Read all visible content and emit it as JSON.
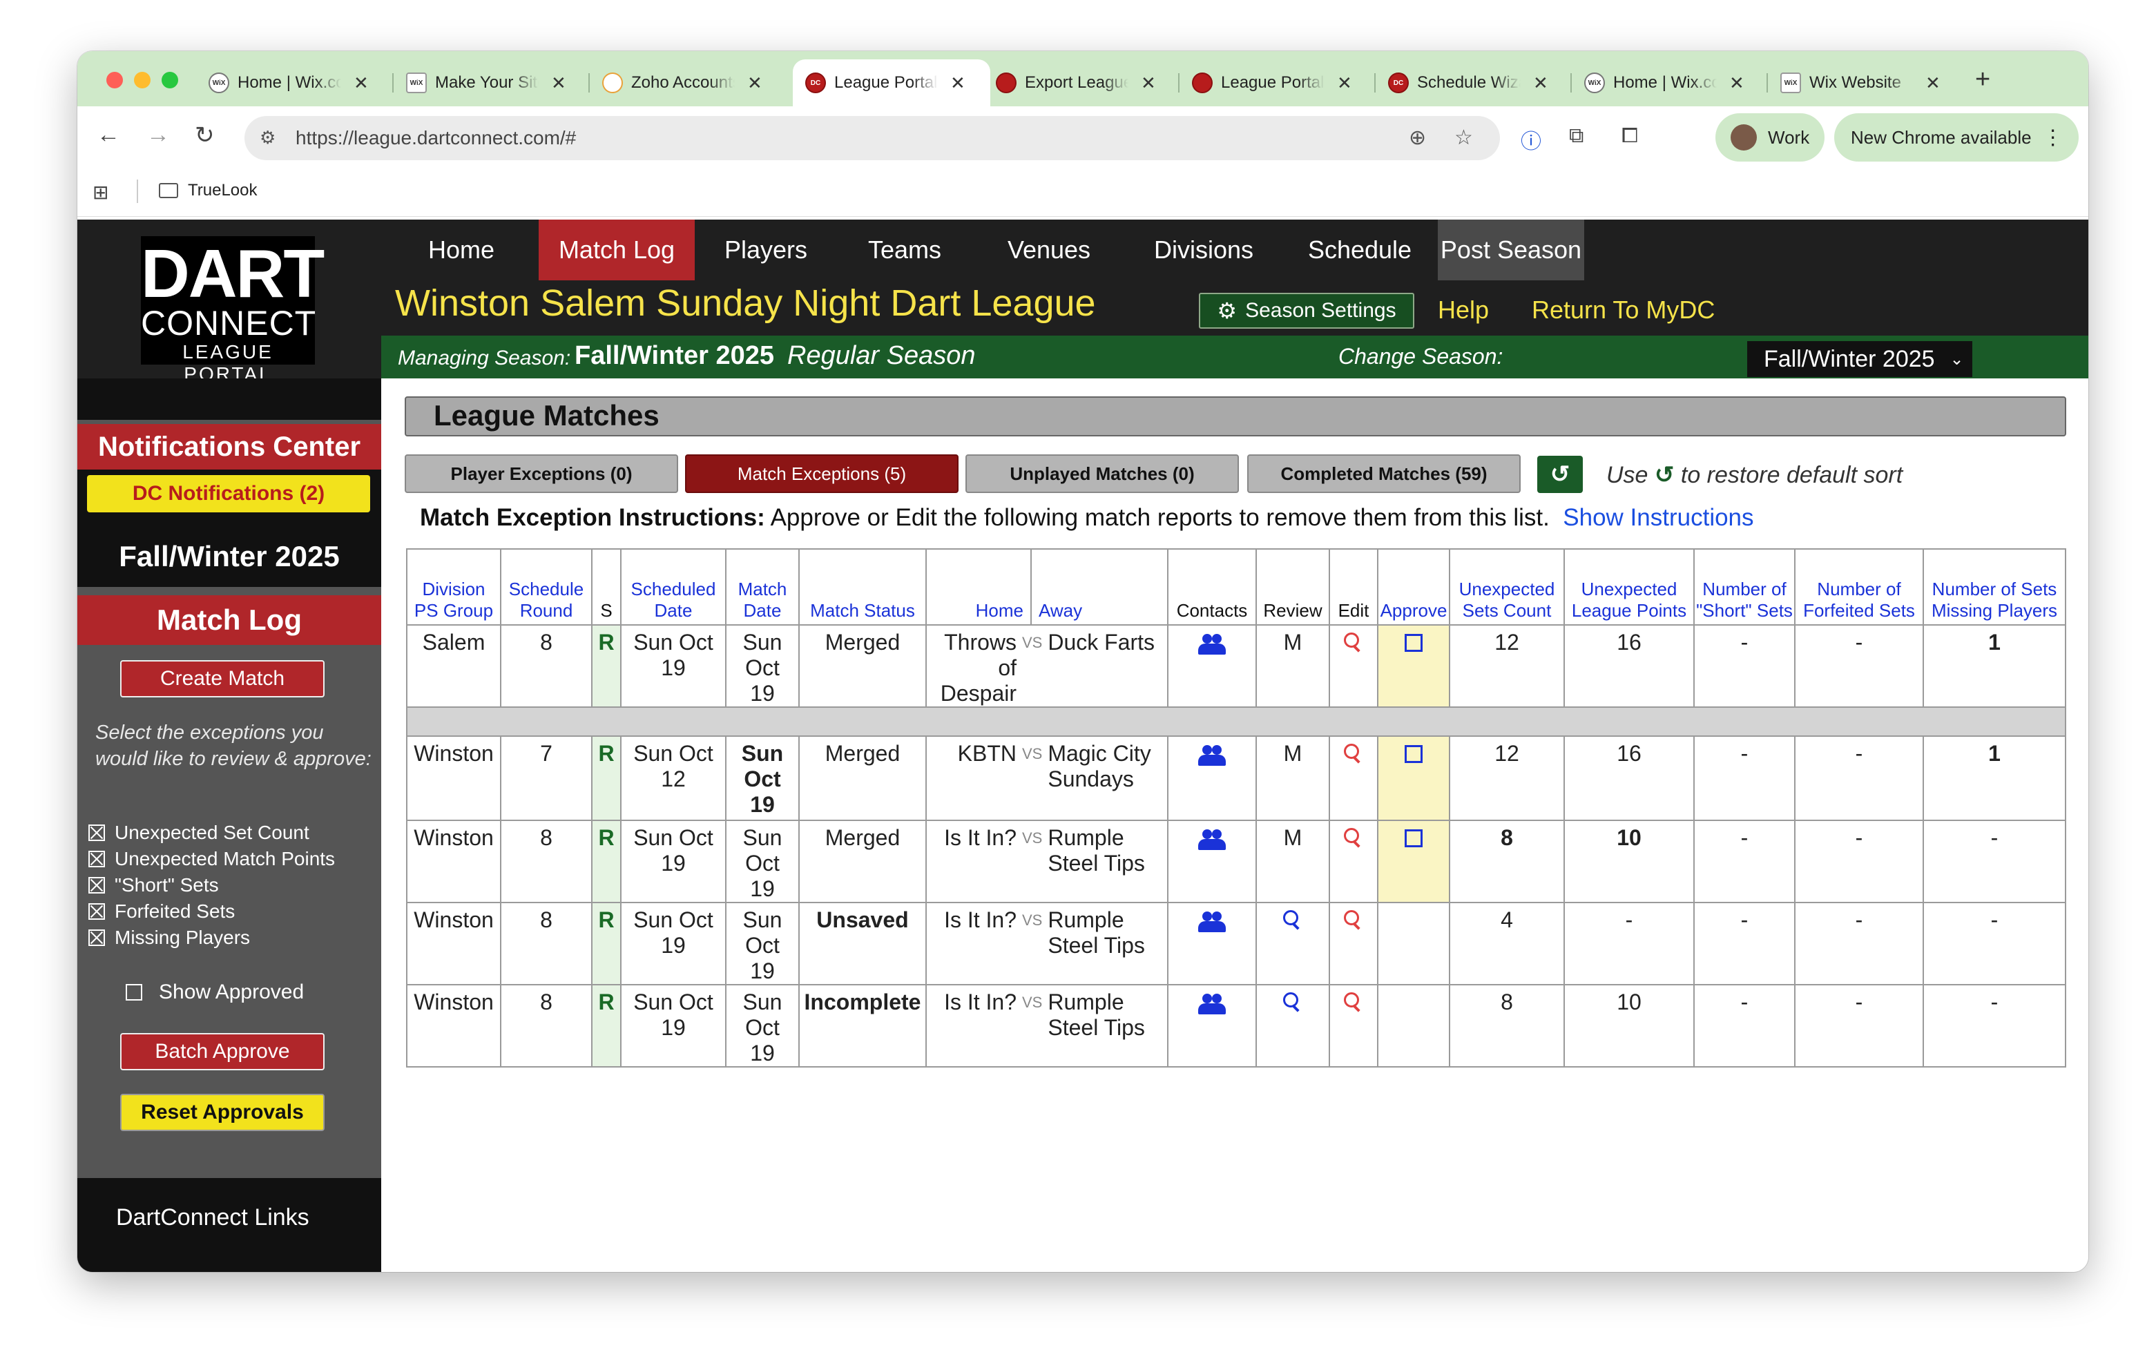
{
  "browser": {
    "tabs": [
      "Home | Wix.com",
      "Make Your Site",
      "Zoho Accounts",
      "League Portal",
      "Export League",
      "League Portal",
      "Schedule Wizard",
      "Home | Wix.com",
      "Wix Website"
    ],
    "url": "https://league.dartconnect.com/#",
    "profile": "Work",
    "update_notice": "New Chrome available",
    "bookmark": "TrueLook"
  },
  "logo": {
    "line1": "DART",
    "line2": "CONNECT",
    "line3": "LEAGUE PORTAL"
  },
  "nav": [
    "Home",
    "Match Log",
    "Players",
    "Teams",
    "Venues",
    "Divisions",
    "Schedule",
    "Post Season"
  ],
  "header": {
    "league_title": "Winston Salem Sunday Night Dart League",
    "season_settings": "Season Settings",
    "help": "Help",
    "return": "Return To MyDC",
    "managing_label": "Managing Season:",
    "managing_season": "Fall/Winter 2025",
    "season_type": "Regular Season",
    "change_label": "Change Season:",
    "selected_season": "Fall/Winter 2025"
  },
  "sidebar": {
    "notifications_title": "Notifications Center",
    "dc_notifications": "DC Notifications (2)",
    "season": "Fall/Winter 2025",
    "section": "Match Log",
    "create_match": "Create Match",
    "instructions": "Select the exceptions you would like to review & approve:",
    "filters": [
      "Unexpected Set Count",
      "Unexpected Match Points",
      "\"Short\" Sets",
      "Forfeited Sets",
      "Missing Players"
    ],
    "show_approved": "Show Approved",
    "batch_approve": "Batch Approve",
    "reset_approvals": "Reset Approvals",
    "links": "DartConnect Links"
  },
  "main": {
    "title": "League Matches",
    "tabs": [
      "Player Exceptions (0)",
      "Match Exceptions (5)",
      "Unplayed Matches (0)",
      "Completed Matches (59)"
    ],
    "restore_pre": "Use",
    "restore_post": "to restore default sort",
    "instr_label": "Match Exception Instructions:",
    "instr_text": "Approve or Edit the following match reports to remove them from this list.",
    "show_instructions": "Show Instructions"
  },
  "table": {
    "headers": {
      "division": "Division PS Group",
      "round": "Schedule Round",
      "s": "S",
      "sched_date": "Scheduled Date",
      "match_date": "Match Date",
      "status": "Match Status",
      "home": "Home",
      "away": "Away",
      "contacts": "Contacts",
      "review": "Review",
      "edit": "Edit",
      "approve": "Approve",
      "sets": "Unexpected Sets Count",
      "points": "Unexpected League Points",
      "short": "Number of \"Short\" Sets",
      "forfeit": "Number of Forfeited Sets",
      "missing": "Number of Sets Missing Players"
    },
    "vs": "VS",
    "rows": [
      {
        "div": "Salem",
        "round": "8",
        "s": "R",
        "sched": "Sun Oct 19",
        "mdate": "Sun Oct 19",
        "status": "Merged",
        "home": "Throws of Despair",
        "away": "Duck Farts",
        "review": "M",
        "sets": "12",
        "points": "16",
        "short": "-",
        "forfeit": "-",
        "missing": "1"
      },
      {
        "div": "Winston",
        "round": "7",
        "s": "R",
        "sched": "Sun Oct 12",
        "mdate": "Sun Oct 19",
        "status": "Merged",
        "home": "KBTN",
        "away": "Magic City Sundays",
        "review": "M",
        "sets": "12",
        "points": "16",
        "short": "-",
        "forfeit": "-",
        "missing": "1"
      },
      {
        "div": "Winston",
        "round": "8",
        "s": "R",
        "sched": "Sun Oct 19",
        "mdate": "Sun Oct 19",
        "status": "Merged",
        "home": "Is It In?",
        "away": "Rumple Steel Tips",
        "review": "M",
        "sets": "8",
        "points": "10",
        "short": "-",
        "forfeit": "-",
        "missing": "-"
      },
      {
        "div": "Winston",
        "round": "8",
        "s": "R",
        "sched": "Sun Oct 19",
        "mdate": "Sun Oct 19",
        "status": "Unsaved",
        "home": "Is It In?",
        "away": "Rumple Steel Tips",
        "review": "",
        "sets": "4",
        "points": "-",
        "short": "-",
        "forfeit": "-",
        "missing": "-"
      },
      {
        "div": "Winston",
        "round": "8",
        "s": "R",
        "sched": "Sun Oct 19",
        "mdate": "Sun Oct 19",
        "status": "Incomplete",
        "home": "Is It In?",
        "away": "Rumple Steel Tips",
        "review": "",
        "sets": "8",
        "points": "10",
        "short": "-",
        "forfeit": "-",
        "missing": "-"
      }
    ]
  }
}
